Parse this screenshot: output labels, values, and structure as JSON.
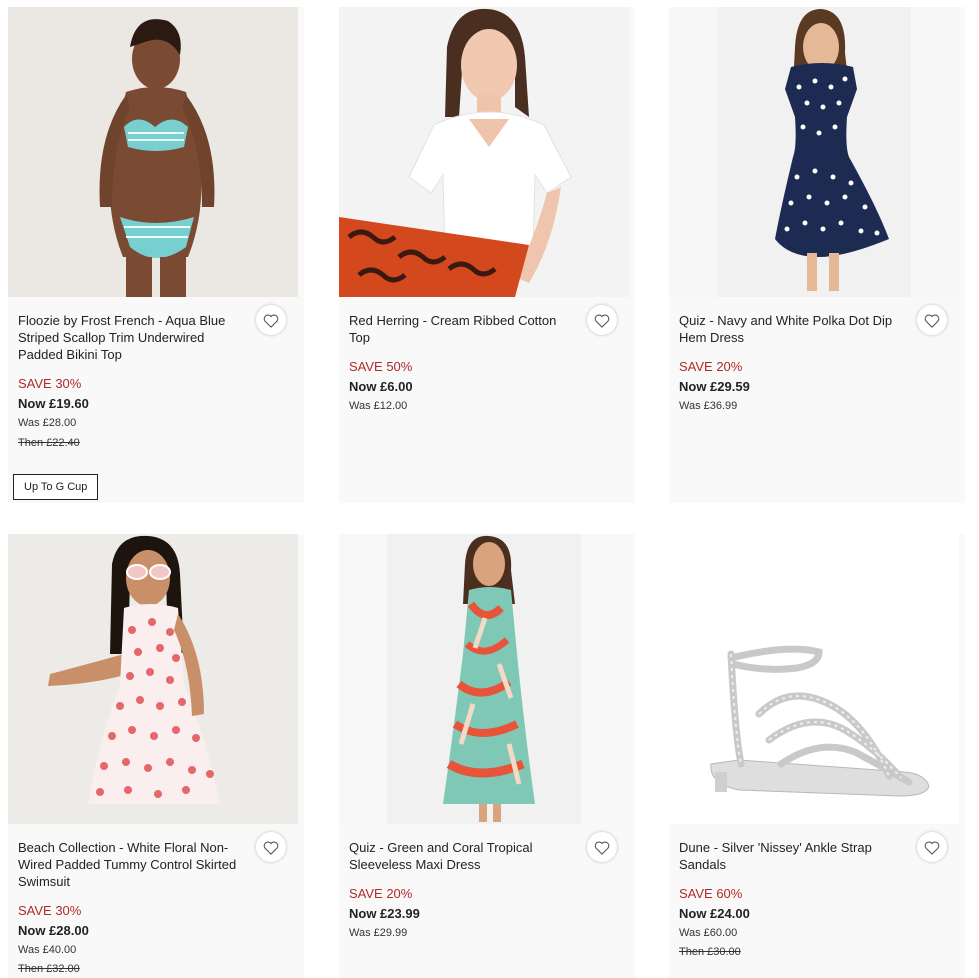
{
  "products": [
    {
      "title": "Floozie by Frost French - Aqua Blue Striped Scallop Trim Underwired Padded Bikini Top",
      "save": "SAVE 30%",
      "now": "Now £19.60",
      "was": "Was £28.00",
      "then": "Then £22.40",
      "badge": "Up To G Cup"
    },
    {
      "title": "Red Herring - Cream Ribbed Cotton Top",
      "save": "SAVE 50%",
      "now": "Now £6.00",
      "was": "Was £12.00"
    },
    {
      "title": "Quiz - Navy and White Polka Dot Dip Hem Dress",
      "save": "SAVE 20%",
      "now": "Now £29.59",
      "was": "Was £36.99"
    },
    {
      "title": "Beach Collection - White Floral Non-Wired Padded Tummy Control Skirted Swimsuit",
      "save": "SAVE 30%",
      "now": "Now £28.00",
      "was": "Was £40.00",
      "then": "Then £32.00"
    },
    {
      "title": "Quiz - Green and Coral Tropical Sleeveless Maxi Dress",
      "save": "SAVE 20%",
      "now": "Now £23.99",
      "was": "Was £29.99"
    },
    {
      "title": "Dune - Silver 'Nissey' Ankle Strap Sandals",
      "save": "SAVE 60%",
      "now": "Now £24.00",
      "was": "Was £60.00",
      "then": "Then £30.00"
    }
  ],
  "icons": {
    "wishlist": "heart-outline-icon"
  },
  "colors": {
    "save": "#b12a2a",
    "card_bg": "#f9f9f9"
  }
}
